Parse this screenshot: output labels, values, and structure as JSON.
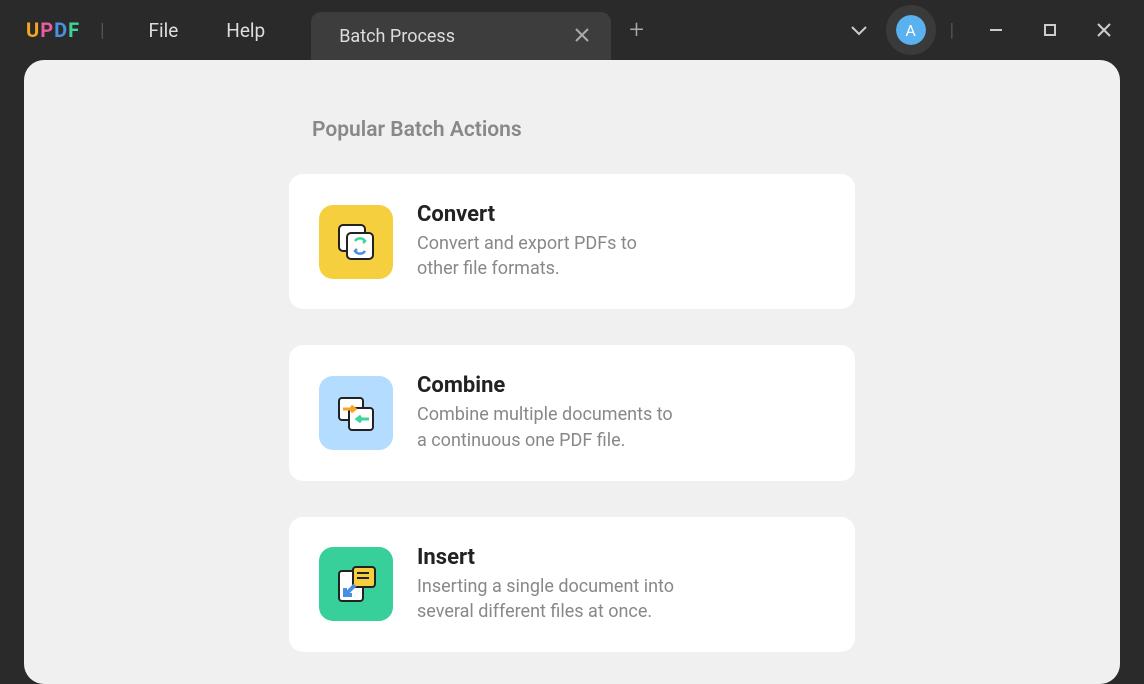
{
  "menu": {
    "file": "File",
    "help": "Help"
  },
  "tab": {
    "label": "Batch Process"
  },
  "avatar": {
    "letter": "A"
  },
  "section_title": "Popular Batch Actions",
  "cards": [
    {
      "title": "Convert",
      "desc": "Convert and export PDFs to other file formats."
    },
    {
      "title": "Combine",
      "desc": "Combine multiple documents to a continuous one PDF file."
    },
    {
      "title": "Insert",
      "desc": "Inserting a single document into several different files at once."
    }
  ]
}
